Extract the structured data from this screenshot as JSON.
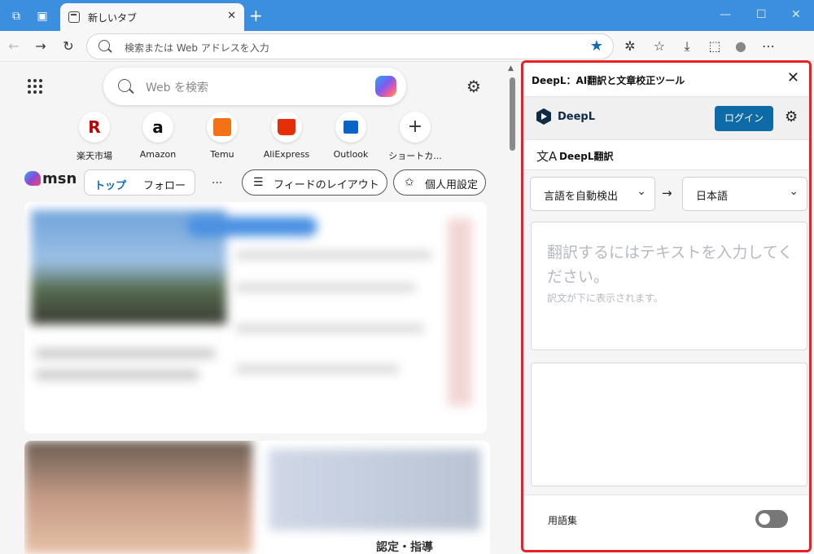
{
  "browser": {
    "tab_title": "新しいタブ",
    "address_placeholder": "検索または Web アドレスを入力"
  },
  "msn": {
    "search_placeholder": "Web を検索",
    "quick_links": [
      {
        "label": "楽天市場"
      },
      {
        "label": "Amazon"
      },
      {
        "label": "Temu"
      },
      {
        "label": "AliExpress"
      },
      {
        "label": "Outlook"
      },
      {
        "label": "ショートカ..."
      }
    ],
    "logo_text": "msn",
    "tabs": [
      "トップ",
      "フォロー"
    ],
    "more": "...",
    "feed_layout": "フィードのレイアウト",
    "personalize": "個人用設定",
    "card_text": "認定・指導"
  },
  "deepl": {
    "panel_title": "DeepL：AI翻訳と文章校正ツール",
    "brand": "DeepL",
    "login_label": "ログイン",
    "section_title": "DeepL翻訳",
    "source_lang": "言語を自動検出",
    "arrow": "→",
    "target_lang": "日本語",
    "input_placeholder": "翻訳するにはテキストを入力してください。",
    "input_hint": "訳文が下に表示されます。",
    "glossary_label": "用語集",
    "glossary_enabled": false
  },
  "colors": {
    "tabstrip": "#3c8ede",
    "login_button": "#0f6ba8",
    "highlight_border": "#e8202a"
  }
}
